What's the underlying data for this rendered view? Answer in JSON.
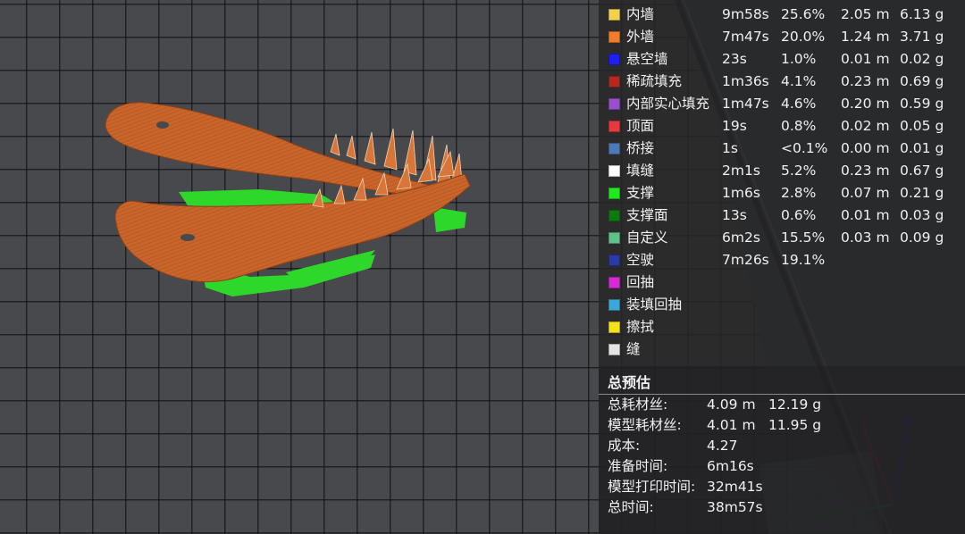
{
  "legend": {
    "rows": [
      {
        "label": "内墙",
        "color": "#f2d24a",
        "time": "9m58s",
        "percent": "25.6%",
        "length": "2.05 m",
        "weight": "6.13 g"
      },
      {
        "label": "外墙",
        "color": "#f07c2c",
        "time": "7m47s",
        "percent": "20.0%",
        "length": "1.24 m",
        "weight": "3.71 g"
      },
      {
        "label": "悬空墙",
        "color": "#1f1ff2",
        "time": "23s",
        "percent": "1.0%",
        "length": "0.01 m",
        "weight": "0.02 g"
      },
      {
        "label": "稀疏填充",
        "color": "#b22a1e",
        "time": "1m36s",
        "percent": "4.1%",
        "length": "0.23 m",
        "weight": "0.69 g"
      },
      {
        "label": "内部实心填充",
        "color": "#9a4fd0",
        "time": "1m47s",
        "percent": "4.6%",
        "length": "0.20 m",
        "weight": "0.59 g"
      },
      {
        "label": "顶面",
        "color": "#e8393f",
        "time": "19s",
        "percent": "0.8%",
        "length": "0.02 m",
        "weight": "0.05 g"
      },
      {
        "label": "桥接",
        "color": "#4c7ab8",
        "time": "1s",
        "percent": "<0.1%",
        "length": "0.00 m",
        "weight": "0.01 g"
      },
      {
        "label": "填缝",
        "color": "#ffffff",
        "time": "2m1s",
        "percent": "5.2%",
        "length": "0.23 m",
        "weight": "0.67 g"
      },
      {
        "label": "支撑",
        "color": "#1ee81e",
        "time": "1m6s",
        "percent": "2.8%",
        "length": "0.07 m",
        "weight": "0.21 g"
      },
      {
        "label": "支撑面",
        "color": "#0e7a0e",
        "time": "13s",
        "percent": "0.6%",
        "length": "0.01 m",
        "weight": "0.03 g"
      },
      {
        "label": "自定义",
        "color": "#5fc08a",
        "time": "6m2s",
        "percent": "15.5%",
        "length": "0.03 m",
        "weight": "0.09 g"
      },
      {
        "label": "空驶",
        "color": "#2a3aa8",
        "time": "7m26s",
        "percent": "19.1%",
        "length": "",
        "weight": ""
      },
      {
        "label": "回抽",
        "color": "#d62ad6",
        "time": "",
        "percent": "",
        "length": "",
        "weight": ""
      },
      {
        "label": "装填回抽",
        "color": "#3aa8d8",
        "time": "",
        "percent": "",
        "length": "",
        "weight": ""
      },
      {
        "label": "擦拭",
        "color": "#f2e21a",
        "time": "",
        "percent": "",
        "length": "",
        "weight": ""
      },
      {
        "label": "缝",
        "color": "#e4e4e4",
        "time": "",
        "percent": "",
        "length": "",
        "weight": ""
      }
    ]
  },
  "summary": {
    "title": "总预估",
    "rows": [
      {
        "label": "总耗材丝:",
        "value": "4.09 m",
        "value2": "12.19 g"
      },
      {
        "label": "模型耗材丝:",
        "value": "4.01 m",
        "value2": "11.95 g"
      },
      {
        "label": "成本:",
        "value": "4.27",
        "value2": ""
      },
      {
        "label": "准备时间:",
        "value": "6m16s",
        "value2": ""
      },
      {
        "label": "模型打印时间:",
        "value": "32m41s",
        "value2": ""
      },
      {
        "label": "总时间:",
        "value": "38m57s",
        "value2": ""
      }
    ]
  },
  "colors": {
    "model": "#c9652a",
    "support": "#2ed82a",
    "axis_x": "#c02828",
    "axis_y": "#22a83a",
    "axis_z": "#2a2ac8"
  },
  "icons": {
    "model": "dinosaur-jaw-model",
    "axes": "xyz-axis-gizmo"
  }
}
